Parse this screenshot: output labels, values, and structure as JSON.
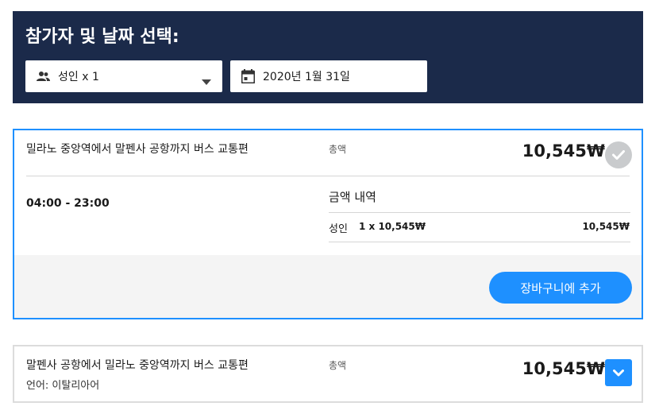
{
  "picker": {
    "title": "참가자 및 날짜 선택:",
    "participants": {
      "value": "성인 x 1",
      "icon": "users-icon"
    },
    "date": {
      "value": "2020년 1월 31일",
      "icon": "calendar-icon"
    }
  },
  "options": [
    {
      "title": "밀라노 중앙역에서 말펜사 공항까지 버스 교통편",
      "total_label": "총액",
      "total_price": "10,545₩",
      "selected": true,
      "time_range": "04:00 - 23:00",
      "breakdown": {
        "title": "금액 내역",
        "rows": [
          {
            "label": "성인",
            "quantity": "1 x 10,545₩",
            "amount": "10,545₩"
          }
        ]
      },
      "add_to_cart": "장바구니에 추가"
    },
    {
      "title": "말펜사 공항에서 밀라노 중앙역까지 버스 교통편",
      "language": "언어: 이탈리아어",
      "total_label": "총액",
      "total_price": "10,545₩",
      "selected": false
    }
  ],
  "colors": {
    "header_bg": "#1b2a4a",
    "accent": "#1e90ff",
    "check_inactive": "#c9cbcd"
  }
}
